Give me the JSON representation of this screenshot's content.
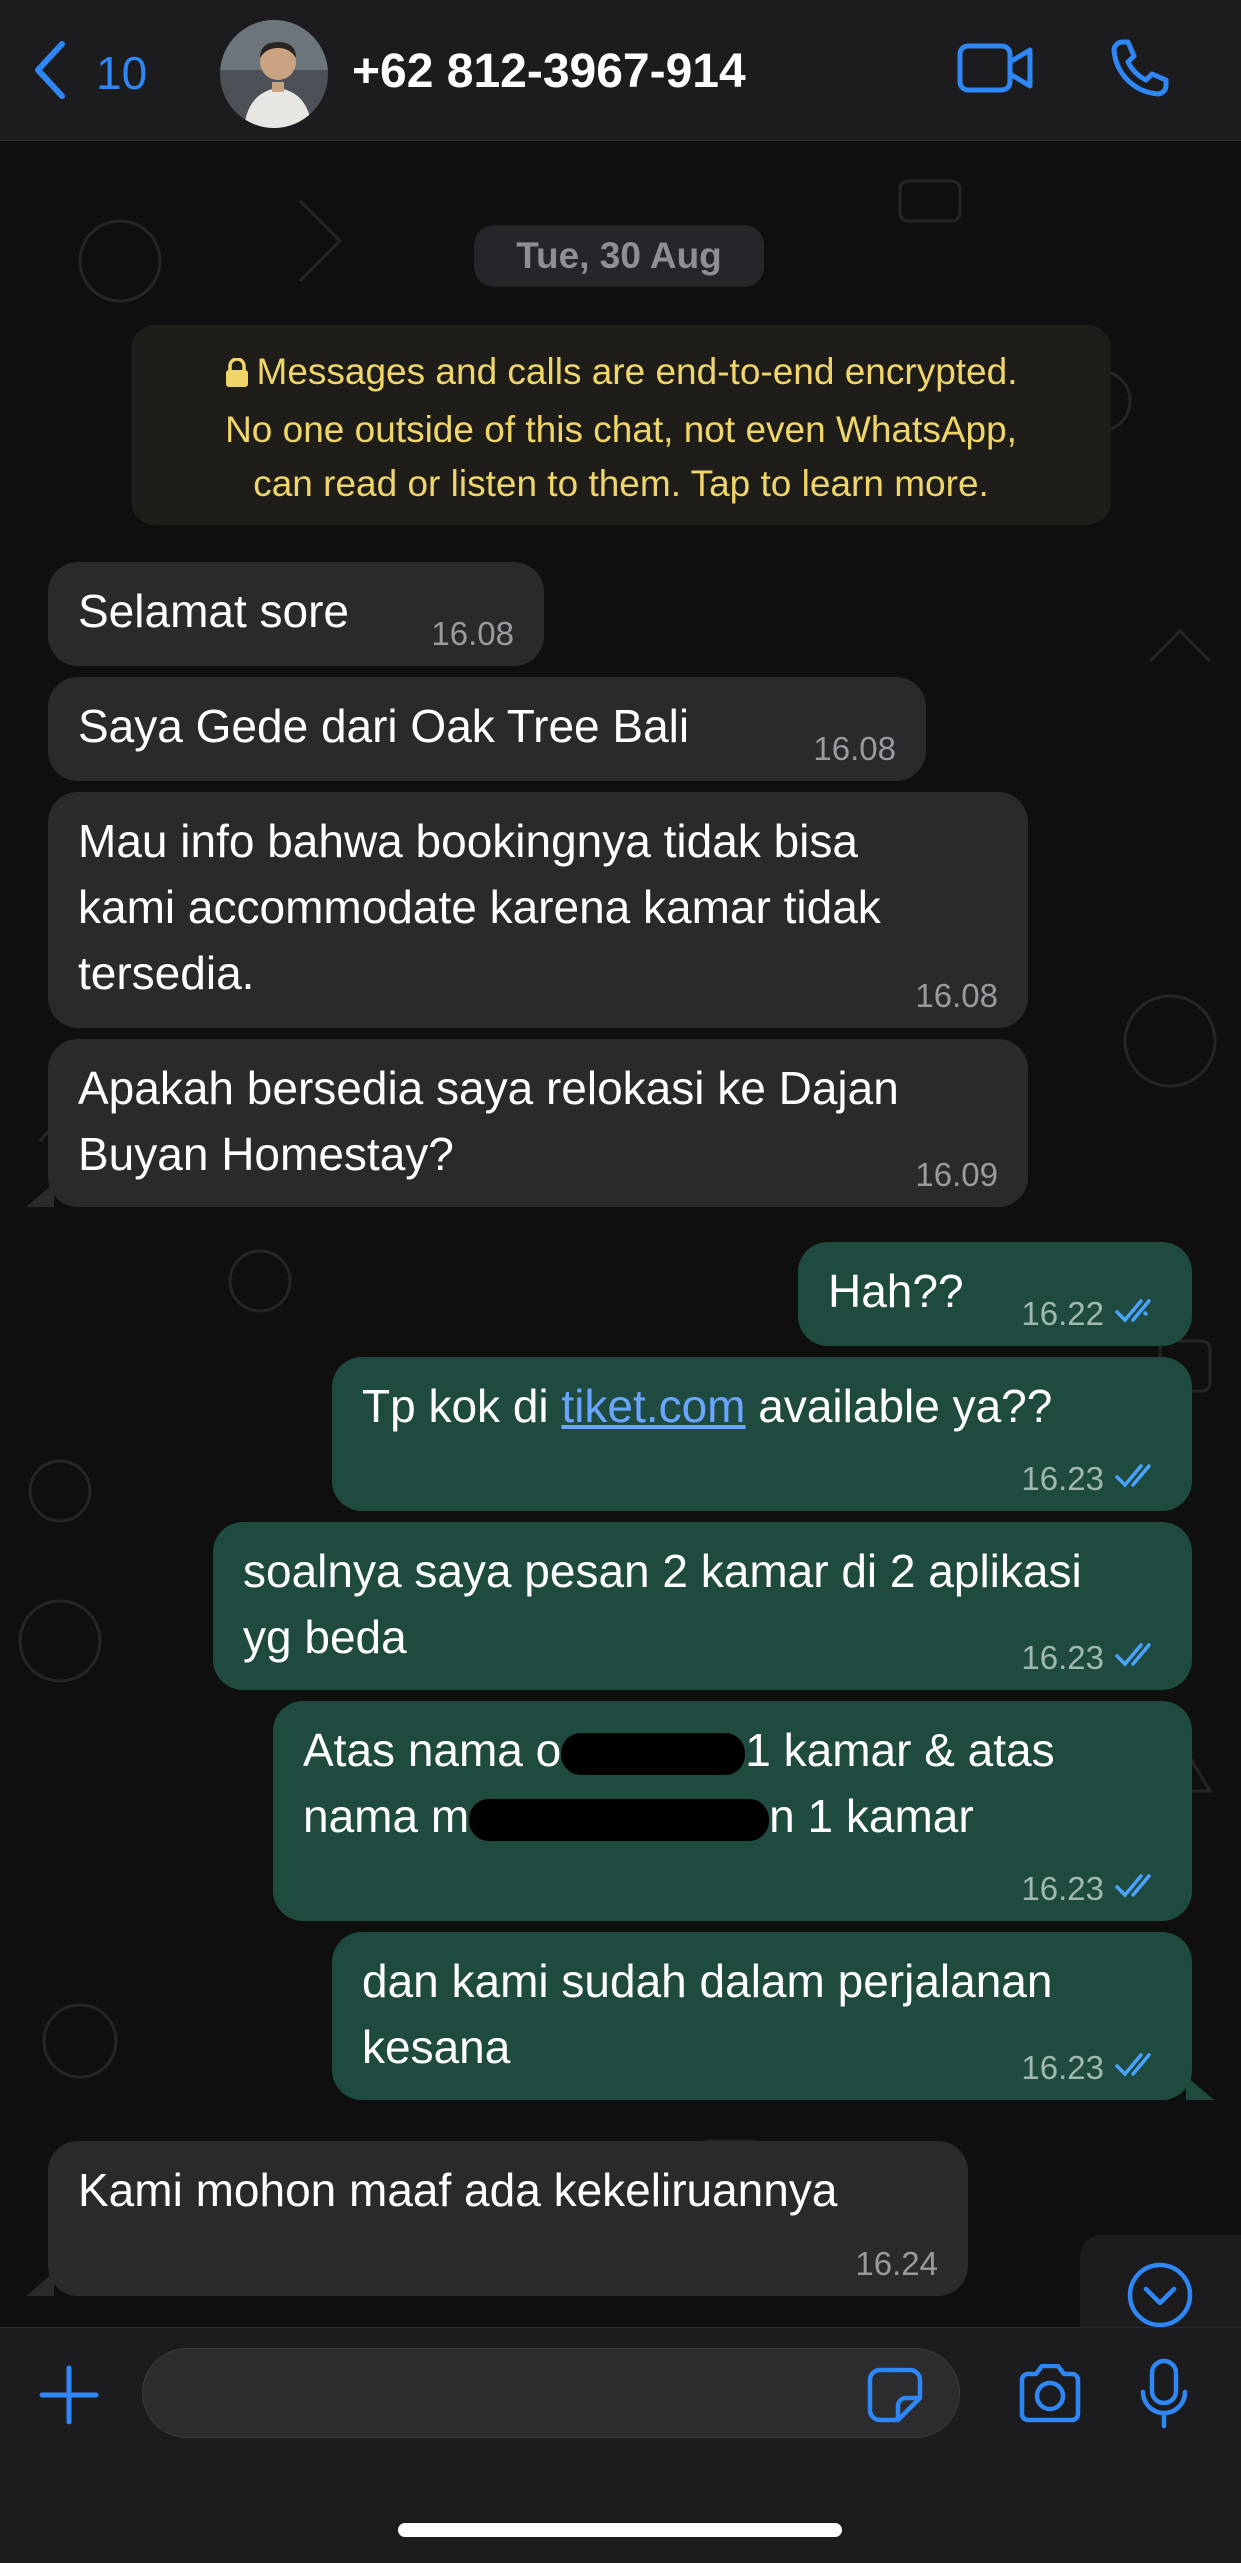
{
  "header": {
    "back_count": "10",
    "contact_name": "+62 812-3967-914",
    "accent_color": "#2f86f5",
    "icons": [
      "chevron-left-icon",
      "video-call-icon",
      "phone-call-icon"
    ]
  },
  "chat": {
    "date_label": "Tue, 30 Aug",
    "encryption_notice": {
      "line1": "Messages and calls are end-to-end encrypted.",
      "line2": "No one outside of this chat, not even WhatsApp,",
      "line3": "can read or listen to them. Tap to learn more."
    },
    "messages": [
      {
        "direction": "in",
        "text": "Selamat sore",
        "time": "16.08"
      },
      {
        "direction": "in",
        "text": "Saya Gede dari Oak Tree Bali",
        "time": "16.08"
      },
      {
        "direction": "in",
        "text": "Mau info bahwa bookingnya tidak bisa\nkami accommodate karena kamar tidak\ntersedia.",
        "time": "16.08"
      },
      {
        "direction": "in",
        "text": "Apakah bersedia saya relokasi ke Dajan\nBuyan Homestay?",
        "time": "16.09"
      },
      {
        "direction": "out",
        "text": "Hah??",
        "time": "16.22"
      },
      {
        "direction": "out",
        "text_before": "Tp kok di ",
        "link": "tiket.com",
        "text_after": " available ya??",
        "time": "16.23"
      },
      {
        "direction": "out",
        "text": "soalnya saya pesan 2 kamar di 2 aplikasi\nyg beda",
        "time": "16.23"
      },
      {
        "direction": "out",
        "line1_a": "Atas nama o",
        "line1_b": "1 kamar & atas",
        "line2_a": "nama m",
        "line2_b": "n 1 kamar",
        "time": "16.23"
      },
      {
        "direction": "out",
        "text": "dan kami sudah dalam perjalanan\nkesana",
        "time": "16.23"
      },
      {
        "direction": "in",
        "text": "Kami mohon maaf ada kekeliruannya",
        "time": "16.24"
      }
    ]
  },
  "composer": {
    "input_value": "",
    "icons": [
      "plus-icon",
      "sticker-icon",
      "camera-icon",
      "microphone-icon"
    ]
  }
}
